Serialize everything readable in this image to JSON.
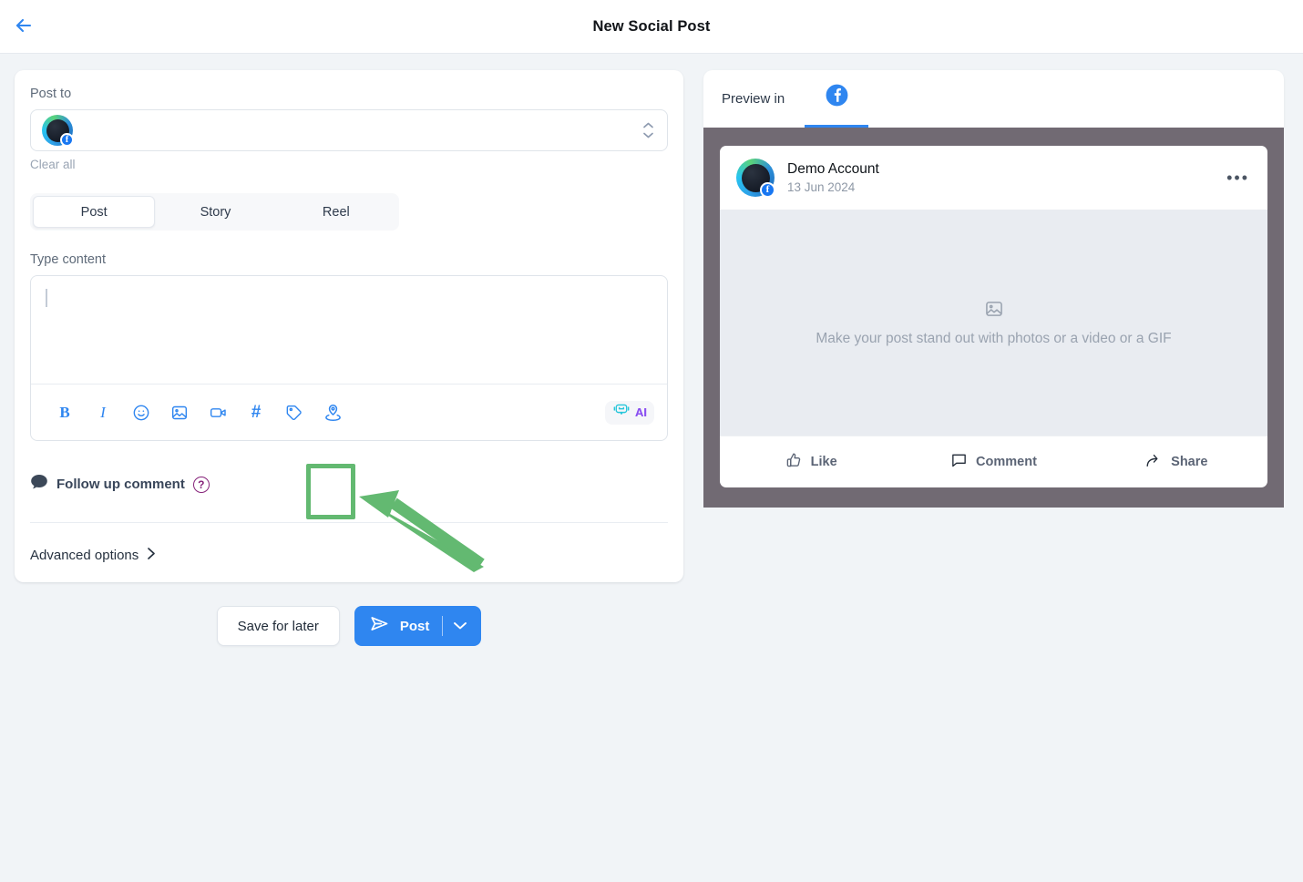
{
  "header": {
    "title": "New Social Post",
    "back_icon": "arrow-left-icon",
    "accent": "#2f86f0"
  },
  "composer": {
    "post_to_label": "Post to",
    "clear_all_label": "Clear all",
    "account_badge": "f",
    "stepper_icon": "chevron-up-down-icon",
    "tabs": [
      {
        "label": "Post",
        "active": true
      },
      {
        "label": "Story",
        "active": false
      },
      {
        "label": "Reel",
        "active": false
      }
    ],
    "content_label": "Type content",
    "content_value": "",
    "toolbar": [
      {
        "name": "bold-icon",
        "glyph": "B"
      },
      {
        "name": "italic-icon",
        "glyph": "I"
      },
      {
        "name": "emoji-icon",
        "glyph": ""
      },
      {
        "name": "image-icon",
        "glyph": ""
      },
      {
        "name": "video-icon",
        "glyph": ""
      },
      {
        "name": "hashtag-icon",
        "glyph": "#"
      },
      {
        "name": "tag-icon",
        "glyph": ""
      },
      {
        "name": "location-pin-icon",
        "glyph": ""
      }
    ],
    "ai_label": "AI",
    "ai_icon": "robot-icon",
    "followup_label": "Follow up comment",
    "followup_icon": "speech-bubble-icon",
    "help_glyph": "?",
    "advanced_label": "Advanced options",
    "advanced_icon": "chevron-right-icon"
  },
  "actions": {
    "save_label": "Save for later",
    "post_label": "Post",
    "post_icon": "send-icon",
    "post_caret_icon": "chevron-down-icon"
  },
  "preview": {
    "title": "Preview in",
    "network_tab_icon": "facebook-icon",
    "network_tab_active": true,
    "frame_color": "#716a73",
    "post": {
      "author": "Demo Account",
      "date": "13 Jun 2024",
      "more_glyph": "•••",
      "media_placeholder": "Make your post stand out with photos or a video or a GIF",
      "media_icon": "image-placeholder-icon",
      "actions": [
        {
          "label": "Like",
          "icon": "thumbs-up-icon"
        },
        {
          "label": "Comment",
          "icon": "comment-icon"
        },
        {
          "label": "Share",
          "icon": "share-icon"
        }
      ]
    }
  },
  "annotation": {
    "highlight_color": "#63b971",
    "target": "location-pin-icon"
  }
}
